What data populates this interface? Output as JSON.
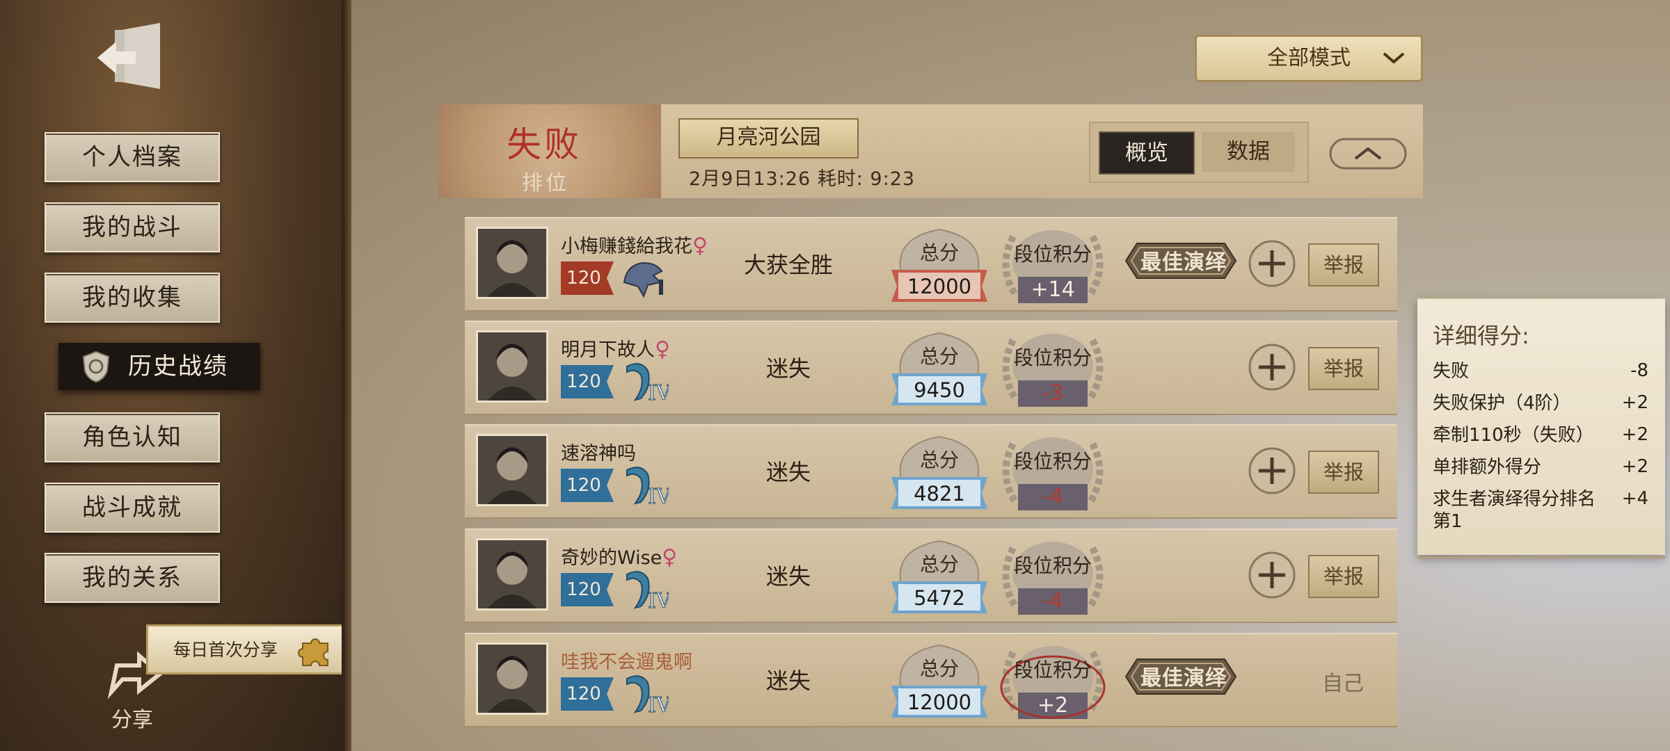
{
  "sidebar": {
    "items": [
      {
        "label": "个人档案"
      },
      {
        "label": "我的战斗"
      },
      {
        "label": "我的收集"
      },
      {
        "label": "历史战绩"
      },
      {
        "label": "角色认知"
      },
      {
        "label": "战斗成就"
      },
      {
        "label": "我的关系"
      }
    ],
    "share_banner": "每日首次分享",
    "share_label": "分享"
  },
  "filter": {
    "mode": "全部模式"
  },
  "match": {
    "result": "失败",
    "type": "排位",
    "map": "月亮河公园",
    "time": "2月9日13:26 耗时: 9:23",
    "tabs": [
      "概览",
      "数据"
    ]
  },
  "labels": {
    "total": "总分",
    "rank": "段位积分",
    "report": "举报",
    "mvp": "最佳演绎",
    "self": "自己"
  },
  "players": [
    {
      "name": "小梅赚錢給我花",
      "female": "♀",
      "level": "120",
      "outcome": "大获全胜",
      "score": "12000",
      "rank_delta": "+14",
      "mvp": true
    },
    {
      "name": "明月下故人",
      "female": "♀",
      "level": "120",
      "outcome": "迷失",
      "score": "9450",
      "rank_delta": "-3",
      "mvp": false
    },
    {
      "name": "速溶神吗",
      "female": "",
      "level": "120",
      "outcome": "迷失",
      "score": "4821",
      "rank_delta": "-4",
      "mvp": false
    },
    {
      "name": "奇妙的Wise",
      "female": "♀",
      "level": "120",
      "outcome": "迷失",
      "score": "5472",
      "rank_delta": "-4",
      "mvp": false
    },
    {
      "name": "哇我不会遛鬼啊",
      "female": "",
      "level": "120",
      "outcome": "迷失",
      "score": "12000",
      "rank_delta": "+2",
      "mvp": true
    }
  ],
  "tooltip": {
    "title": "详细得分:",
    "rows": [
      {
        "label": "失败",
        "value": "-8"
      },
      {
        "label": "失败保护（4阶）",
        "value": "+2"
      },
      {
        "label": "牵制110秒（失败）",
        "value": "+2"
      },
      {
        "label": "单排额外得分",
        "value": "+2"
      },
      {
        "label": "求生者演绎得分排名第1",
        "value": "+4"
      }
    ]
  },
  "colors": {
    "accent_red": "#b0302a",
    "positive": "#f2ebe0",
    "negative": "#b23a2e",
    "hunter_flag": "#a33a25",
    "survivor_flag": "#2f6f9a"
  },
  "icons": [
    "exit-icon",
    "shield-icon",
    "puzzle-icon",
    "share-icon",
    "chevron-down-icon",
    "chevron-up-icon",
    "plus-icon"
  ]
}
